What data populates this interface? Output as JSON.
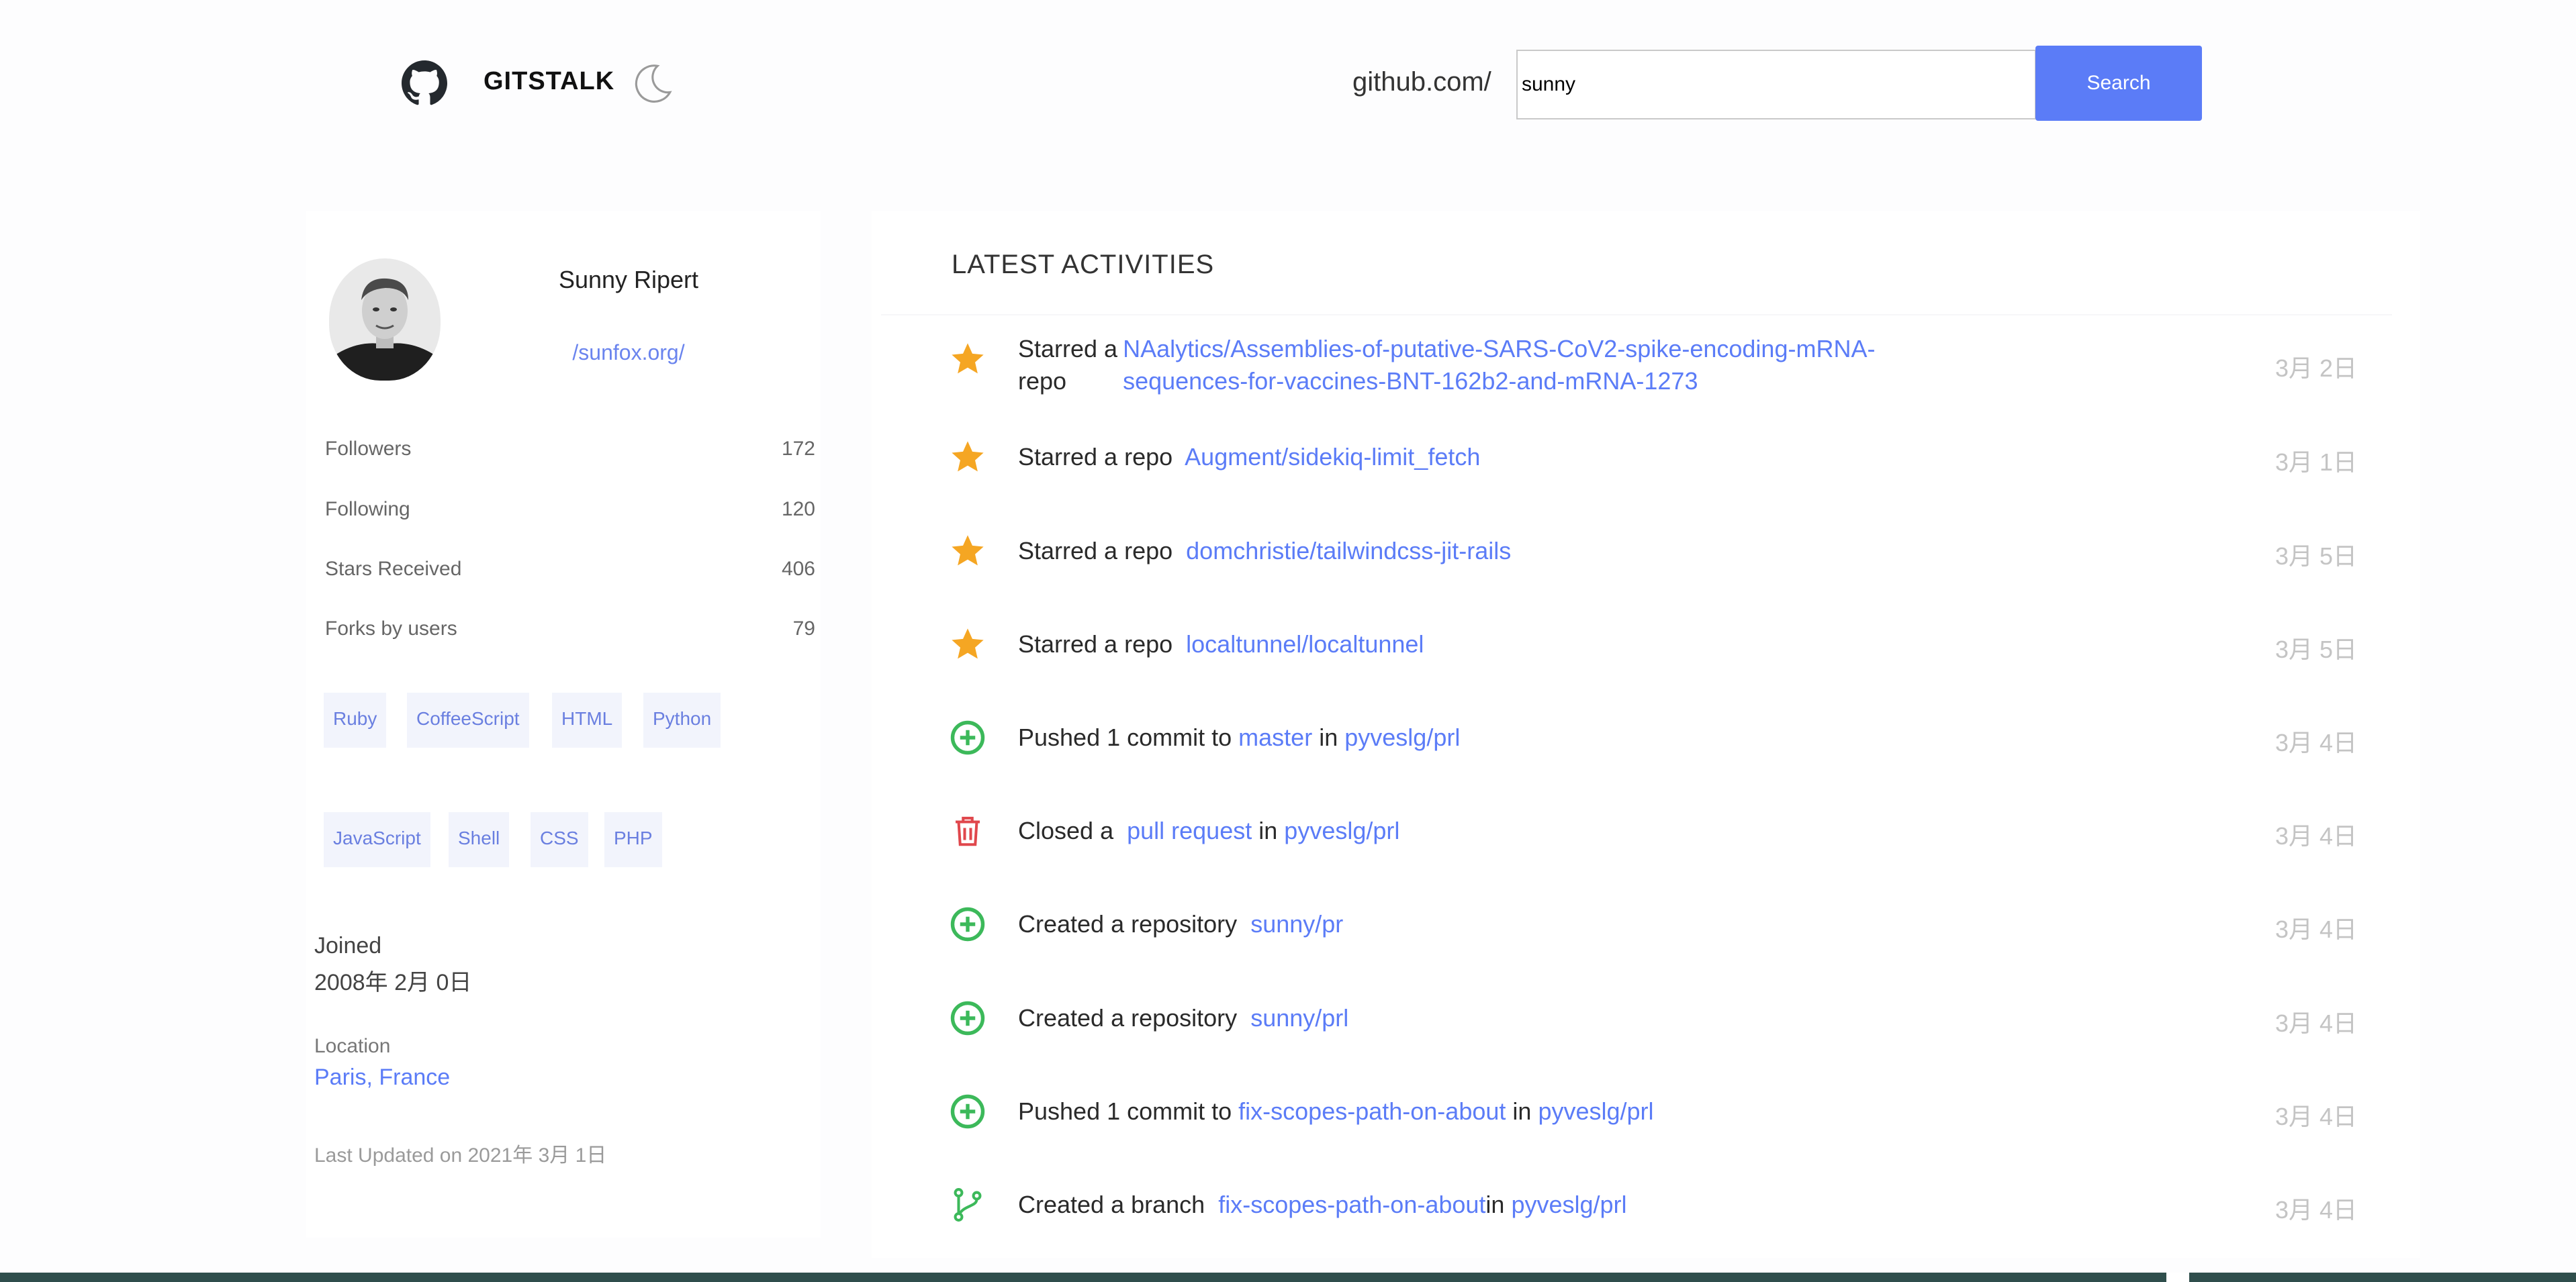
{
  "header": {
    "brand": "GITSTALK",
    "url_prefix": "github.com/",
    "search_value": "sunny",
    "search_button": "Search",
    "accent_color": "#5b7cf7"
  },
  "profile": {
    "name": "Sunny Ripert",
    "url": "/sunfox.org/",
    "stats": [
      {
        "label": "Followers",
        "value": "172"
      },
      {
        "label": "Following",
        "value": "120"
      },
      {
        "label": "Stars Received",
        "value": "406"
      },
      {
        "label": "Forks by users",
        "value": "79"
      }
    ],
    "languages": [
      "Ruby",
      "CoffeeScript",
      "HTML",
      "Python",
      "JavaScript",
      "Shell",
      "CSS",
      "PHP"
    ],
    "joined_label": "Joined",
    "joined_value": "2008年 2月 0日",
    "location_label": "Location",
    "location_value": "Paris, France",
    "last_updated": "Last Updated on 2021年 3月 1日"
  },
  "activities": {
    "title": "LATEST ACTIVITIES",
    "items": [
      {
        "icon": "star-icon",
        "action_a": "Starred a",
        "action_b": "repo",
        "link1a": "NAalytics/Assemblies-of-putative-SARS-CoV2-spike-encoding-mRNA-",
        "link1b": "sequences-for-vaccines-BNT-162b2-and-mRNA-1273",
        "date": "3月 2日"
      },
      {
        "icon": "star-icon",
        "action": "Starred a repo",
        "link1": "Augment/sidekiq-limit_fetch",
        "date": "3月 1日"
      },
      {
        "icon": "star-icon",
        "action": "Starred a repo",
        "link1": "domchristie/tailwindcss-jit-rails",
        "date": "3月 5日"
      },
      {
        "icon": "star-icon",
        "action": "Starred a repo",
        "link1": "localtunnel/localtunnel",
        "date": "3月 5日"
      },
      {
        "icon": "plus-circle-icon",
        "action": "Pushed 1 commit to",
        "link1": "master",
        "mid": "in",
        "link2": "pyveslg/prl",
        "date": "3月 4日"
      },
      {
        "icon": "trash-icon",
        "action": "Closed a",
        "link1": "pull request",
        "mid": "in",
        "link2": "pyveslg/prl",
        "date": "3月 4日"
      },
      {
        "icon": "plus-circle-icon",
        "action": "Created a repository",
        "link1": "sunny/pr",
        "date": "3月 4日"
      },
      {
        "icon": "plus-circle-icon",
        "action": "Created a repository",
        "link1": "sunny/prl",
        "date": "3月 4日"
      },
      {
        "icon": "plus-circle-icon",
        "action": "Pushed 1 commit to",
        "link1": "fix-scopes-path-on-about",
        "mid": "in",
        "link2": "pyveslg/prl",
        "date": "3月 4日"
      },
      {
        "icon": "branch-icon",
        "action": "Created a branch",
        "link1": "fix-scopes-path-on-about",
        "mid": "in",
        "link2": "pyveslg/prl",
        "date": "3月 4日"
      }
    ]
  }
}
